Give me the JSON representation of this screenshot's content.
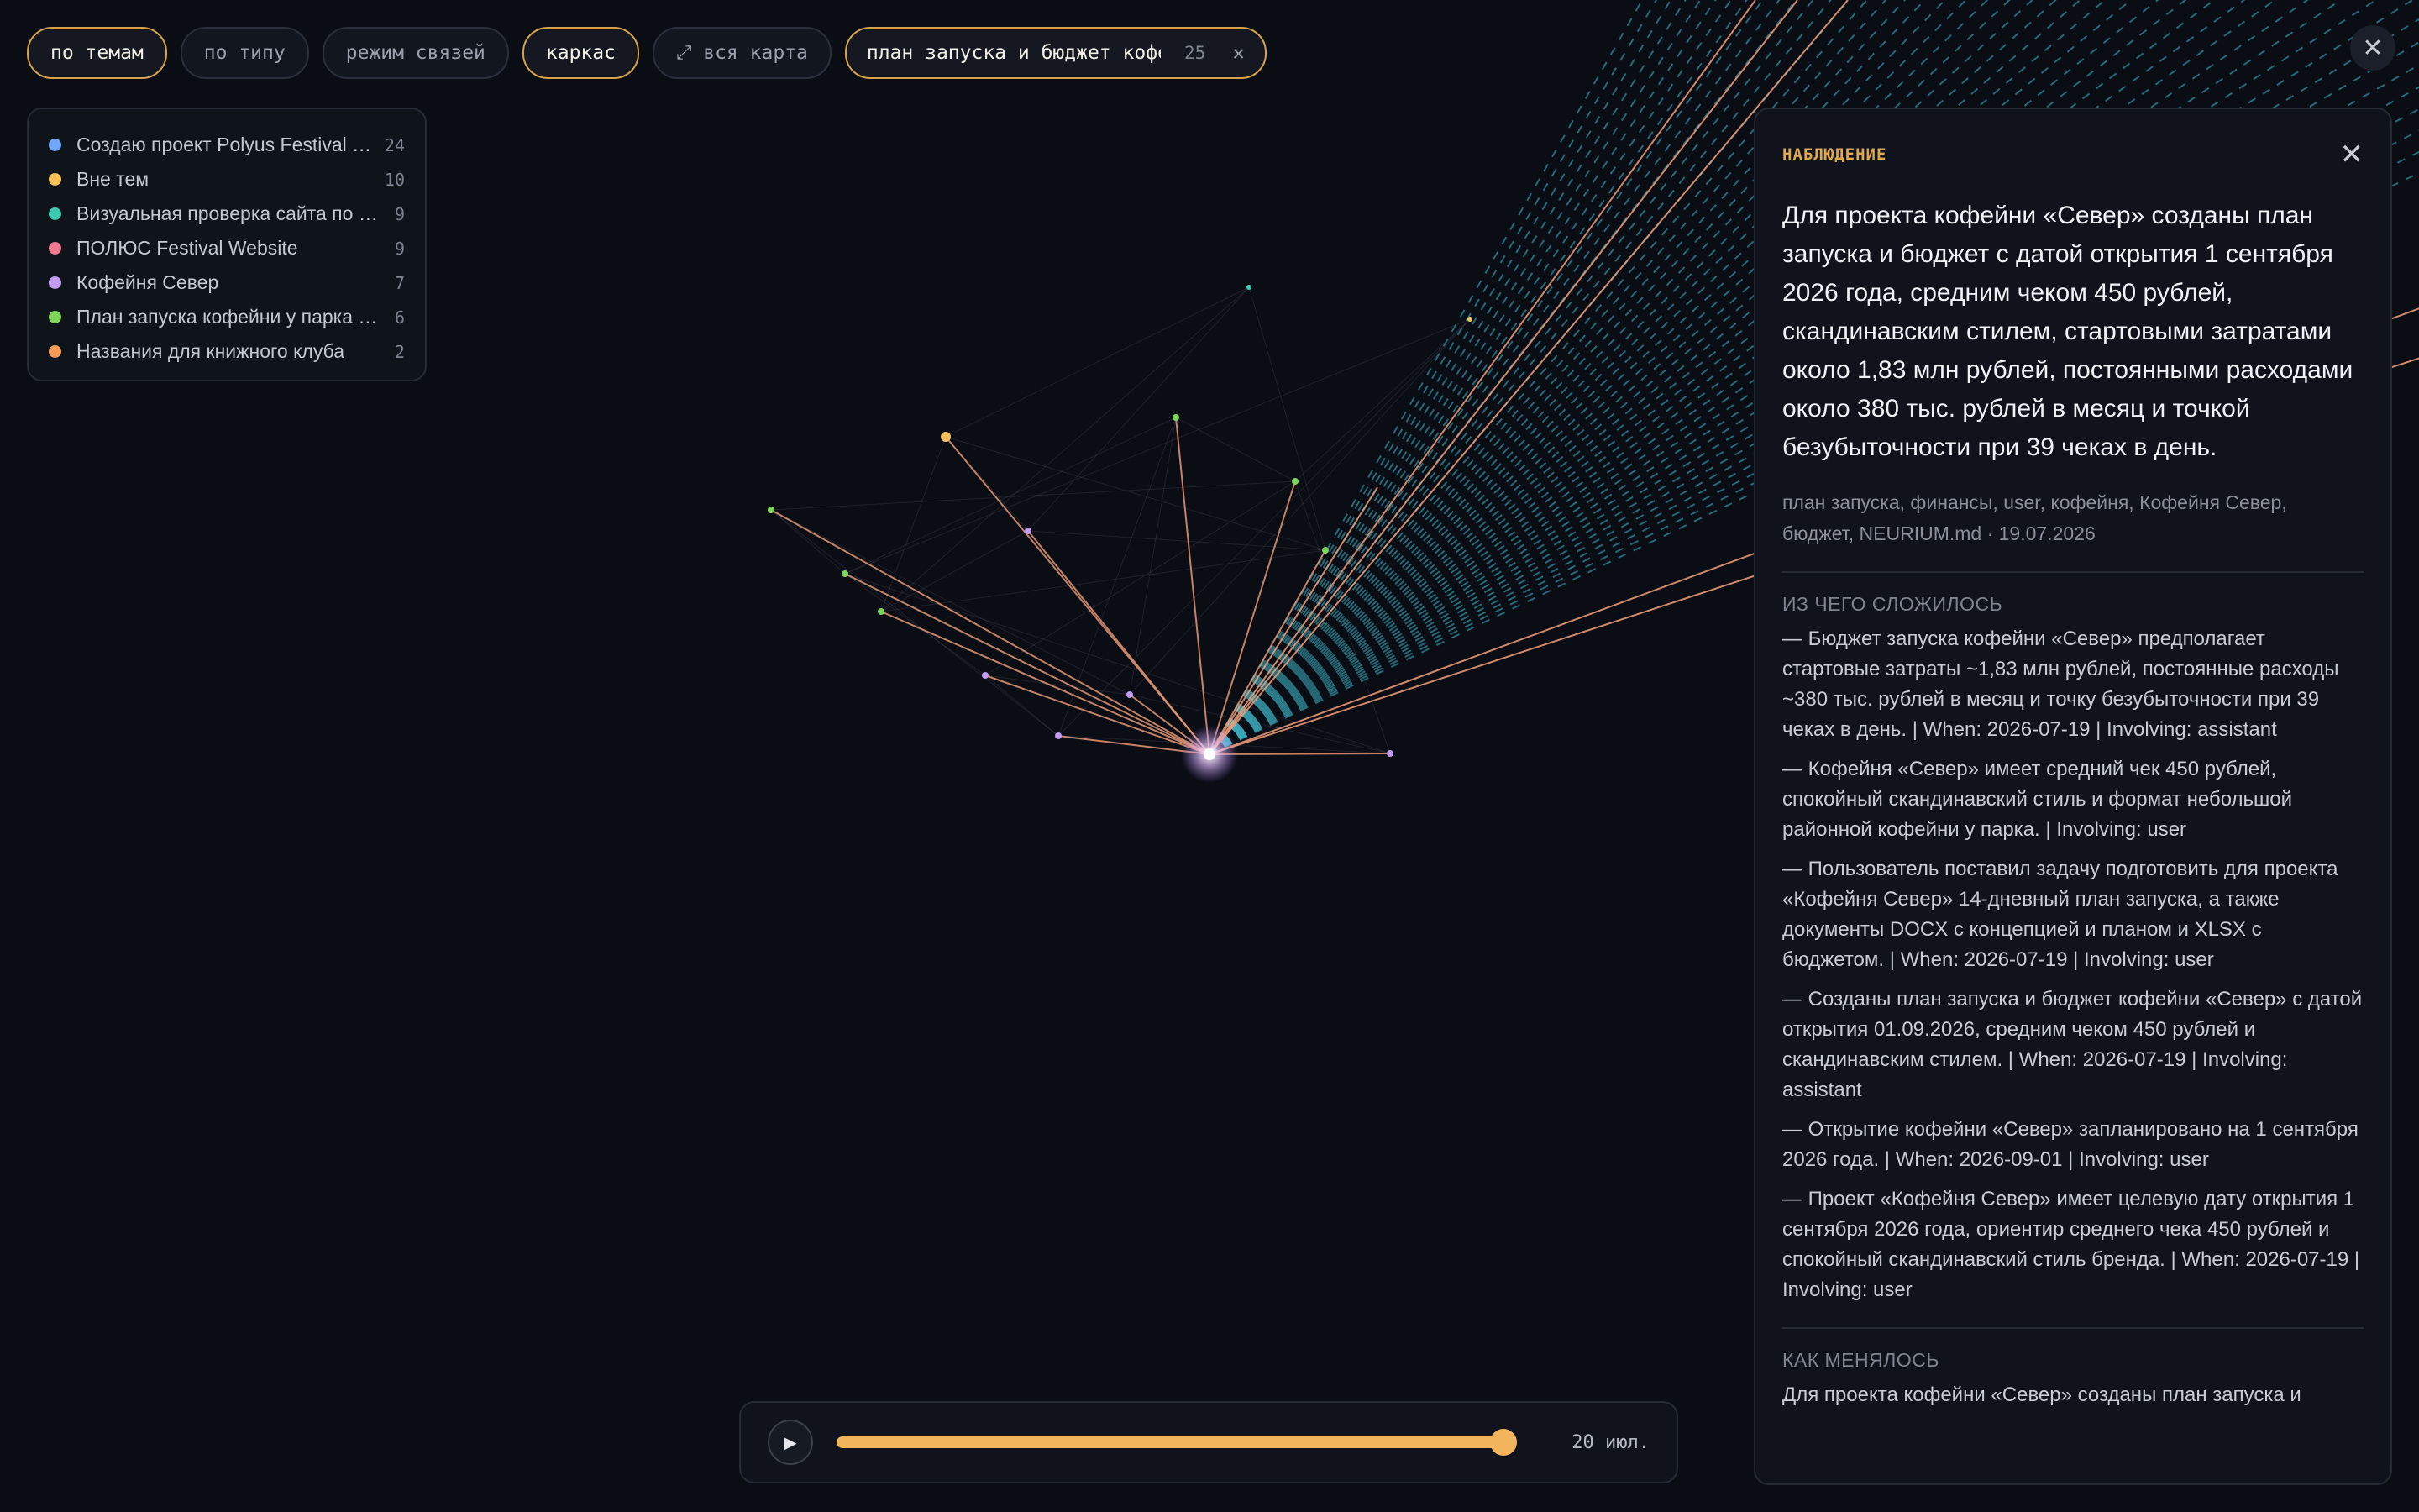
{
  "toolbar": {
    "by_topic": "по темам",
    "by_type": "по типу",
    "links_mode": "режим связей",
    "wireframe": "каркас",
    "full_map": "⤢ вся карта",
    "search_value": "план запуска и бюджет кофейни «Север»",
    "search_count": "25",
    "search_clear_icon": "close-icon"
  },
  "close_icon": "close-icon",
  "legend": [
    {
      "label": "Создаю проект Polyus Festival в стиле",
      "count": "24",
      "color": "#6ea8f7"
    },
    {
      "label": "Вне тем",
      "count": "10",
      "color": "#f6c15a"
    },
    {
      "label": "Визуальная проверка сайта по промпту",
      "count": "9",
      "color": "#3cc9b0"
    },
    {
      "label": "ПОЛЮС Festival Website",
      "count": "9",
      "color": "#f07a92"
    },
    {
      "label": "Кофейня Север",
      "count": "7",
      "color": "#c29cf2"
    },
    {
      "label": "План запуска кофейни у парка за две недели",
      "count": "6",
      "color": "#7fd45a"
    },
    {
      "label": "Названия для книжного клуба",
      "count": "2",
      "color": "#f59c5a"
    }
  ],
  "panel": {
    "kind": "НАБЛЮДЕНИЕ",
    "title": "Для проекта кофейни «Север» созданы план запуска и бюджет с датой открытия 1 сентября 2026 года, средним чеком 450 рублей, скандинавским стилем, стартовыми затратами около 1,83 млн рублей, постоянными расходами около 380 тыс. рублей в месяц и точкой безубыточности при 39 чеках в день.",
    "meta": "план запуска, финансы, user, кофейня, Кофейня Север, бюджет, NEURIUM.md · 19.07.2026",
    "section_sources": "ИЗ ЧЕГО СЛОЖИЛОСЬ",
    "items": [
      "— Бюджет запуска кофейни «Север» предполагает стартовые затраты ~1,83 млн рублей, постоянные расходы ~380 тыс. рублей в месяц и точку безубыточности при 39 чеках в день. | When: 2026-07-19 | Involving: assistant",
      "— Кофейня «Север» имеет средний чек 450 рублей, спокойный скандинавский стиль и формат небольшой районной кофейни у парка. | Involving: user",
      "— Пользователь поставил задачу подготовить для проекта «Кофейня Север» 14-дневный план запуска, а также документы DOCX с концепцией и планом и XLSX с бюджетом. | When: 2026-07-19 | Involving: user",
      "— Созданы план запуска и бюджет кофейни «Север» с датой открытия 01.09.2026, средним чеком 450 рублей и скандинавским стилем. | When: 2026-07-19 | Involving: assistant",
      "— Открытие кофейни «Север» запланировано на 1 сентября 2026 года. | When: 2026-09-01 | Involving: user",
      "— Проект «Кофейня Север» имеет целевую дату открытия 1 сентября 2026 года, ориентир среднего чека 450 рублей и спокойный скандинавский стиль бренда. | When: 2026-07-19 | Involving: user"
    ],
    "section_history": "КАК МЕНЯЛОСЬ",
    "history_text": "Для проекта кофейни «Север» созданы план запуска и"
  },
  "timeline": {
    "play_icon": "play-icon",
    "date": "20 июл.",
    "progress": 1.0
  },
  "colors": {
    "accent": "#f2b45c",
    "edge_orange": "#f3a07a",
    "edge_teal": "#3fb6c8",
    "background": "#0a0d14"
  }
}
